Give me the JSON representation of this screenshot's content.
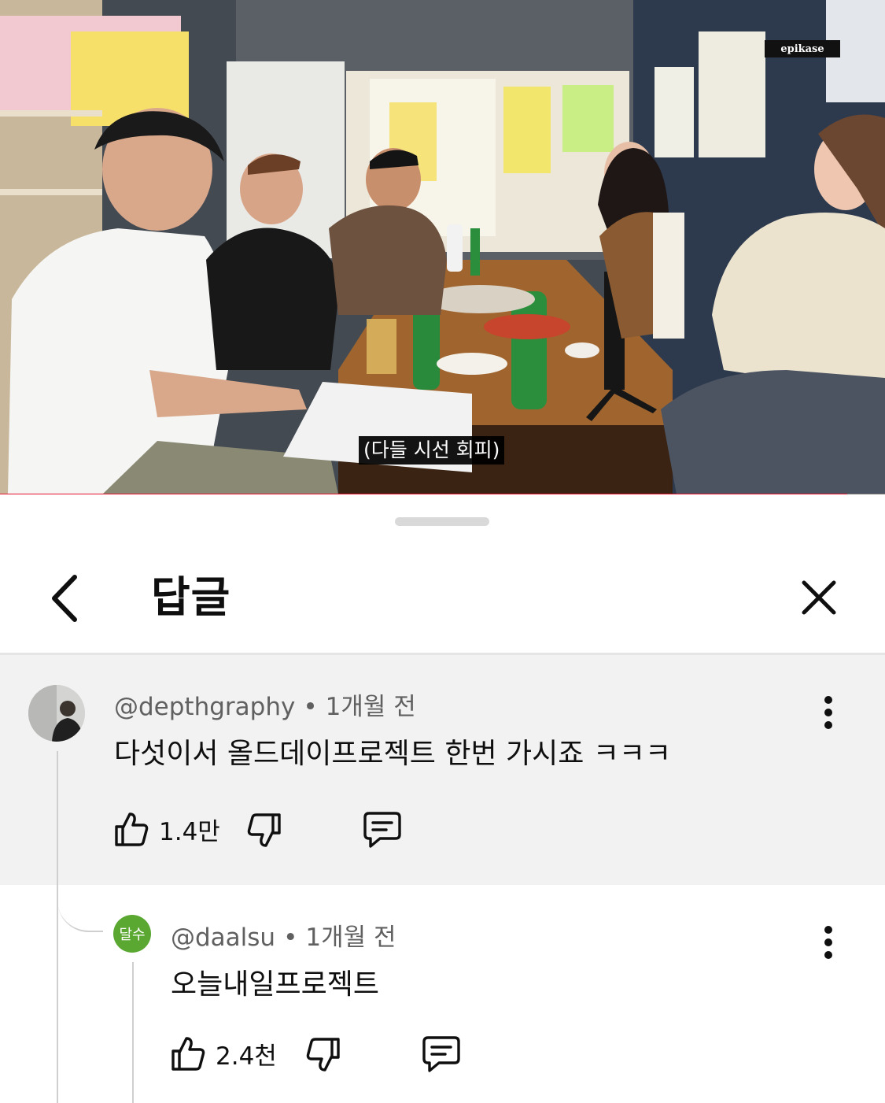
{
  "video": {
    "watermark": "epikase",
    "subtitle": "(다들 시선 회피)",
    "progress_fraction": 0.957,
    "progress_color": "#e8112d"
  },
  "sheet": {
    "title": "답글",
    "back_icon": "chevron-left-icon",
    "close_icon": "close-icon"
  },
  "comments": [
    {
      "author": "@depthgraphy",
      "separator": "•",
      "time": "1개월 전",
      "text": "다섯이서 올드데이프로젝트 한번 가시죠 ㅋㅋㅋ",
      "likes": "1.4만",
      "avatar_style": "photo"
    },
    {
      "author": "@daalsu",
      "separator": "•",
      "time": "1개월 전",
      "text": "오늘내일프로젝트",
      "likes": "2.4천",
      "avatar_label": "달수",
      "avatar_color": "#5aa832"
    }
  ]
}
